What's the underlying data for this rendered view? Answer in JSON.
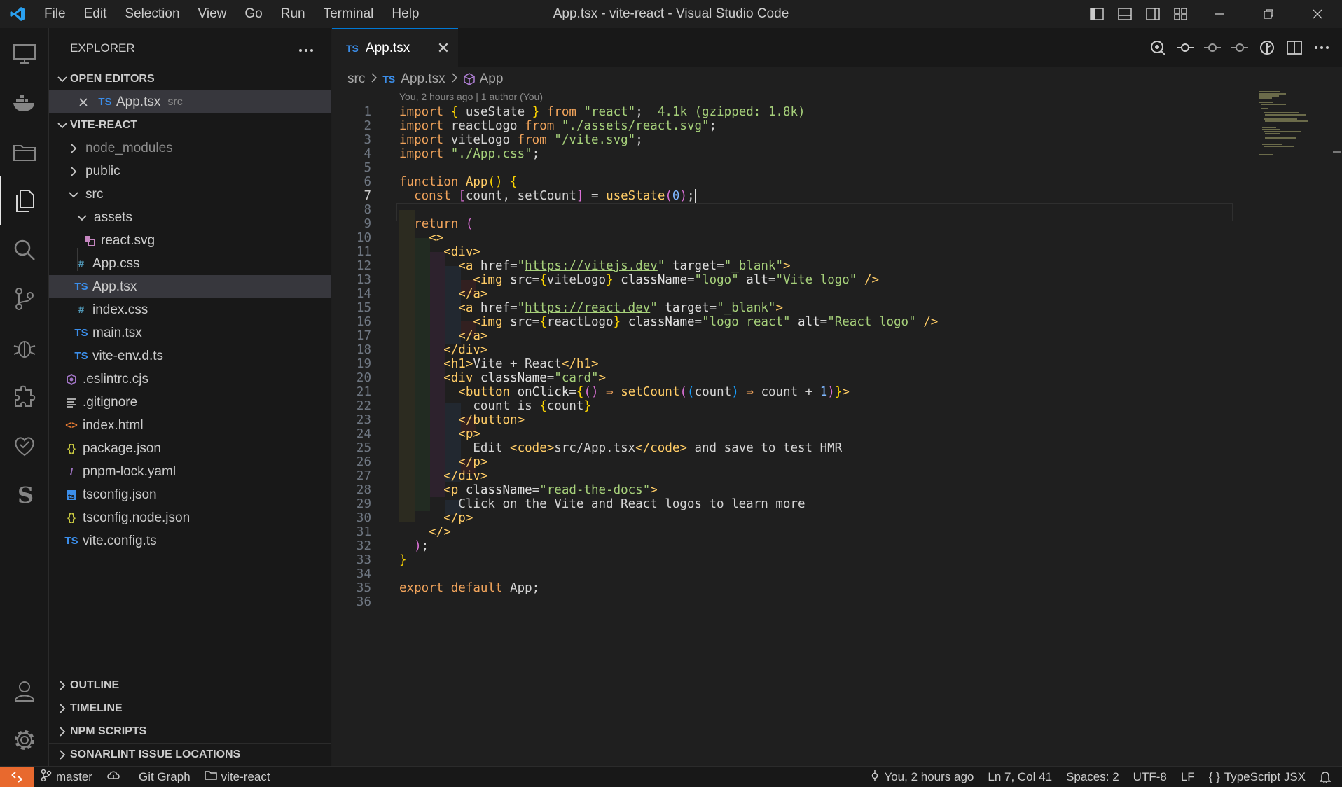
{
  "window": {
    "title": "App.tsx - vite-react - Visual Studio Code",
    "menus": [
      "File",
      "Edit",
      "Selection",
      "View",
      "Go",
      "Run",
      "Terminal",
      "Help"
    ]
  },
  "explorer": {
    "header": "EXPLORER",
    "open_editors_label": "OPEN EDITORS",
    "open_editor": {
      "name": "App.tsx",
      "folder": "src"
    },
    "project_label": "VITE-REACT",
    "tree": [
      {
        "name": "node_modules",
        "type": "folder"
      },
      {
        "name": "public",
        "type": "folder"
      },
      {
        "name": "src",
        "type": "folder-open"
      },
      {
        "name": "assets",
        "type": "folder-open"
      },
      {
        "name": "react.svg",
        "type": "svg"
      },
      {
        "name": "App.css",
        "type": "css"
      },
      {
        "name": "App.tsx",
        "type": "ts"
      },
      {
        "name": "index.css",
        "type": "css"
      },
      {
        "name": "main.tsx",
        "type": "ts"
      },
      {
        "name": "vite-env.d.ts",
        "type": "ts"
      },
      {
        "name": ".eslintrc.cjs",
        "type": "eslint"
      },
      {
        "name": ".gitignore",
        "type": "git"
      },
      {
        "name": "index.html",
        "type": "html"
      },
      {
        "name": "package.json",
        "type": "json"
      },
      {
        "name": "pnpm-lock.yaml",
        "type": "yaml"
      },
      {
        "name": "tsconfig.json",
        "type": "tsconfig"
      },
      {
        "name": "tsconfig.node.json",
        "type": "json"
      },
      {
        "name": "vite.config.ts",
        "type": "ts"
      }
    ],
    "bottom_sections": [
      "OUTLINE",
      "TIMELINE",
      "NPM SCRIPTS",
      "SONARLINT ISSUE LOCATIONS"
    ]
  },
  "editor": {
    "tab": {
      "name": "App.tsx",
      "lang": "TS",
      "close": "✕"
    },
    "breadcrumb": {
      "folder": "src",
      "file": "App.tsx",
      "symbol": "App"
    },
    "blame": "You, 2 hours ago | 1 author (You)",
    "import_cost": "4.1k (gzipped: 1.8k)",
    "current_line": 7
  },
  "statusbar": {
    "branch": "master",
    "git_graph": "Git Graph",
    "folder": "vite-react",
    "blame": "You, 2 hours ago",
    "position": "Ln 7, Col 41",
    "spaces": "Spaces: 2",
    "encoding": "UTF-8",
    "eol": "LF",
    "language": "TypeScript JSX"
  },
  "colors": {
    "accent": "#0078d4",
    "remote": "#e8692e",
    "ts_icon": "#3b8eea"
  }
}
